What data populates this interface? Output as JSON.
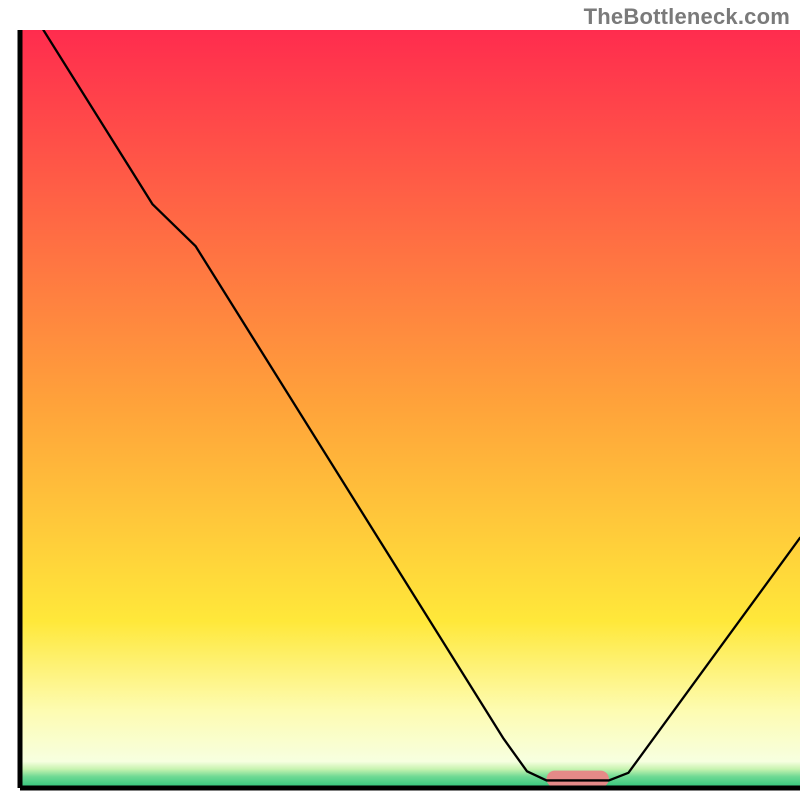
{
  "watermark": {
    "text": "TheBottleneck.com"
  },
  "chart_data": {
    "type": "line",
    "title": "",
    "xlabel": "",
    "ylabel": "",
    "xlim": [
      0,
      100
    ],
    "ylim": [
      0,
      100
    ],
    "legend": false,
    "grid": false,
    "annotations": [
      "TheBottleneck.com"
    ],
    "background_gradient": {
      "stops": [
        {
          "offset": 0.0,
          "color": "#ff2c4e"
        },
        {
          "offset": 0.5,
          "color": "#ffa43a"
        },
        {
          "offset": 0.78,
          "color": "#ffe83a"
        },
        {
          "offset": 0.9,
          "color": "#fdfcb3"
        },
        {
          "offset": 0.965,
          "color": "#f7ffe0"
        },
        {
          "offset": 0.975,
          "color": "#c7f3b0"
        },
        {
          "offset": 0.985,
          "color": "#6fd994"
        },
        {
          "offset": 1.0,
          "color": "#2ec47a"
        }
      ]
    },
    "axes_color": "#000000",
    "curve": {
      "stroke": "#000000",
      "stroke_width": 2.3,
      "points": [
        {
          "x": 3.0,
          "y": 100.0
        },
        {
          "x": 17.0,
          "y": 77.0
        },
        {
          "x": 22.5,
          "y": 71.5
        },
        {
          "x": 62.0,
          "y": 6.5
        },
        {
          "x": 65.0,
          "y": 2.2
        },
        {
          "x": 67.5,
          "y": 1.0
        },
        {
          "x": 75.5,
          "y": 1.0
        },
        {
          "x": 78.0,
          "y": 2.0
        },
        {
          "x": 100.0,
          "y": 33.0
        }
      ]
    },
    "marker": {
      "shape": "rounded-rect",
      "x_center": 71.5,
      "y_center": 1.2,
      "width": 8.0,
      "height": 2.2,
      "rx": 1.1,
      "fill": "#e58a88"
    }
  }
}
